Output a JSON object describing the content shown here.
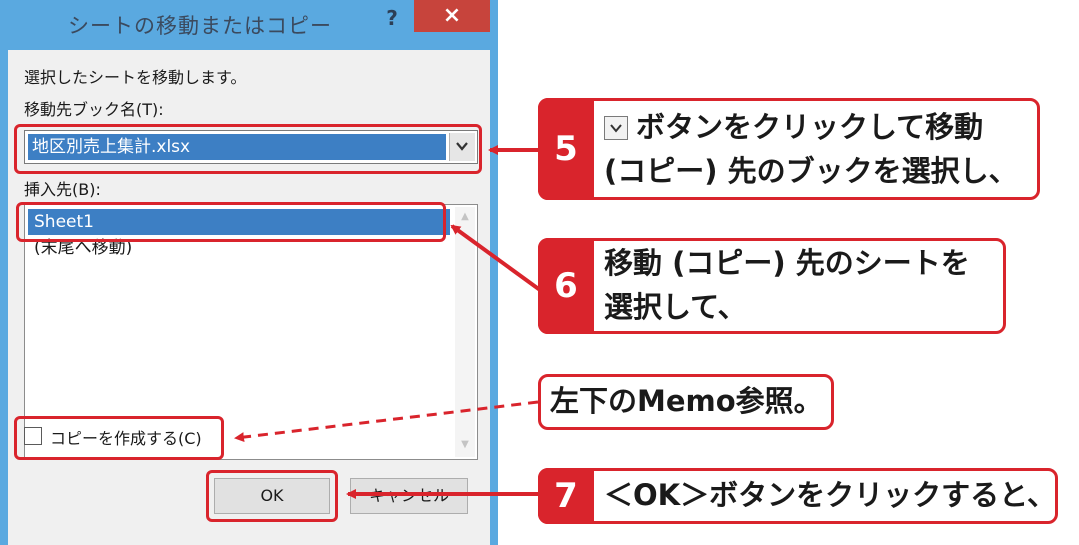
{
  "dialog": {
    "title": "シートの移動またはコピー",
    "help_label": "?",
    "close_label": "×",
    "instruction": "選択したシートを移動します。",
    "book_label": "移動先ブック名(T):",
    "book_value": "地区別売上集計.xlsx",
    "insert_label": "挿入先(B):",
    "list_items": [
      "Sheet1",
      "(末尾へ移動)"
    ],
    "copy_checkbox_label": "コピーを作成する(C)",
    "copy_checked": false,
    "ok_label": "OK",
    "cancel_label": "キャンセル"
  },
  "callouts": {
    "c5": {
      "number": "5",
      "line1": "ボタンをクリックして移動",
      "line2": "(コピー) 先のブックを選択し、"
    },
    "c6": {
      "number": "6",
      "line1": "移動 (コピー) 先のシートを",
      "line2": "選択して、"
    },
    "memo": {
      "text": "左下のMemo参照。"
    },
    "c7": {
      "number": "7",
      "text": "＜OK＞ボタンをクリックすると、"
    }
  },
  "colors": {
    "accent_red": "#d9242c",
    "window_frame": "#5aa9e0",
    "selection_blue": "#3d7fc4"
  }
}
